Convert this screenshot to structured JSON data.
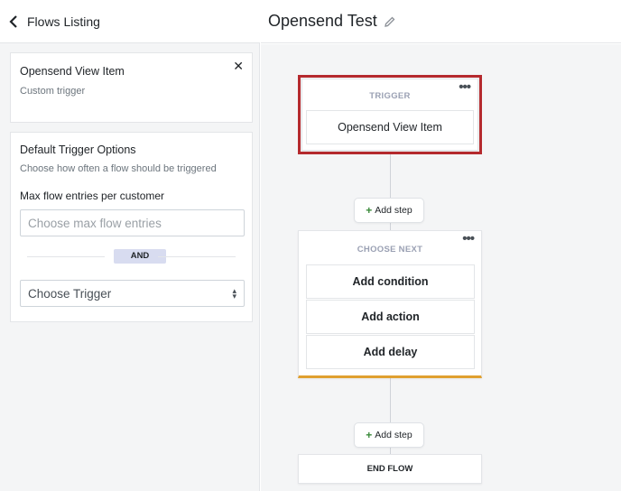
{
  "left_panel": {
    "header_title": "Flows Listing",
    "trigger_card": {
      "title": "Opensend View Item",
      "subtitle": "Custom trigger"
    },
    "options_card": {
      "title": "Default Trigger Options",
      "subtitle": "Choose how often a flow should be triggered",
      "max_label": "Max flow entries per customer",
      "max_placeholder": "Choose max flow entries",
      "and_label": "AND",
      "trigger_select_value": "Choose Trigger"
    }
  },
  "canvas": {
    "flow_title": "Opensend Test",
    "trigger_node": {
      "label": "TRIGGER",
      "item": "Opensend View Item"
    },
    "add_step_label": "Add step",
    "choose_next": {
      "label": "CHOOSE NEXT",
      "options": [
        "Add condition",
        "Add action",
        "Add delay"
      ]
    },
    "end_label": "END FLOW"
  },
  "colors": {
    "highlight": "#b52a2e",
    "choose_next_accent": "#e0a030",
    "and_badge": "#d8dcf0"
  },
  "icons": [
    "chevron-left-icon",
    "close-icon",
    "pencil-icon",
    "more-dots-icon",
    "plus-icon",
    "select-caret-icon"
  ]
}
